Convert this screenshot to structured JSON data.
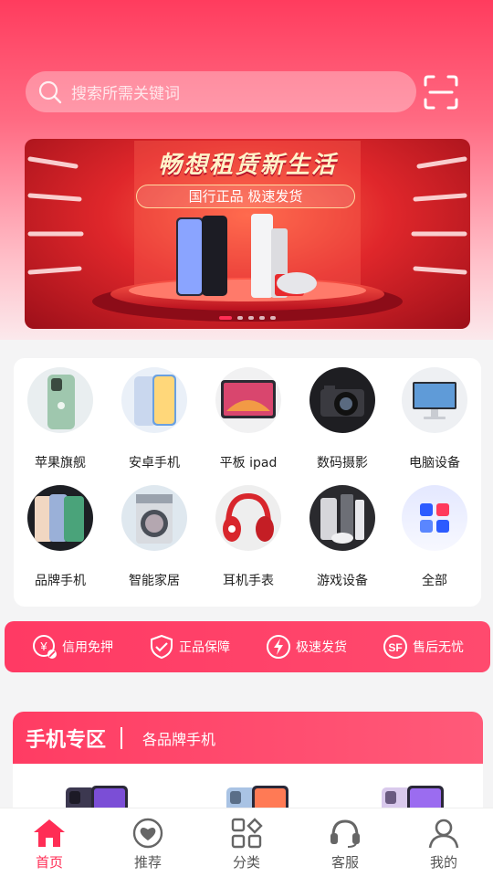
{
  "search": {
    "placeholder": "搜索所需关键词"
  },
  "banner": {
    "title": "畅想租赁新生活",
    "subtitle": "国行正品  极速发货",
    "slide_count": 5,
    "active_slide": 1
  },
  "categories": [
    {
      "label": "苹果旗舰",
      "icon": "green-iphone"
    },
    {
      "label": "安卓手机",
      "icon": "android-phone"
    },
    {
      "label": "平板 ipad",
      "icon": "tablet"
    },
    {
      "label": "数码摄影",
      "icon": "camera"
    },
    {
      "label": "电脑设备",
      "icon": "imac"
    },
    {
      "label": "品牌手机",
      "icon": "brand-phones"
    },
    {
      "label": "智能家居",
      "icon": "washing-machine"
    },
    {
      "label": "耳机手表",
      "icon": "red-headphones"
    },
    {
      "label": "游戏设备",
      "icon": "game-console"
    },
    {
      "label": "全部",
      "icon": "grid-icon"
    }
  ],
  "benefits": [
    {
      "label": "信用免押",
      "icon": "yen-icon"
    },
    {
      "label": "正品保障",
      "icon": "shield-check-icon"
    },
    {
      "label": "极速发货",
      "icon": "lightning-icon"
    },
    {
      "label": "售后无忧",
      "icon": "sf-icon"
    }
  ],
  "zone": {
    "title": "手机专区",
    "subtitle": "各品牌手机"
  },
  "tabs": [
    {
      "label": "首页",
      "icon": "home-icon",
      "active": true
    },
    {
      "label": "推荐",
      "icon": "heart-icon",
      "active": false
    },
    {
      "label": "分类",
      "icon": "category-icon",
      "active": false
    },
    {
      "label": "客服",
      "icon": "headset-icon",
      "active": false
    },
    {
      "label": "我的",
      "icon": "user-icon",
      "active": false
    }
  ],
  "colors": {
    "accent": "#ff2d55",
    "hero_top": "#ff3c5e"
  }
}
